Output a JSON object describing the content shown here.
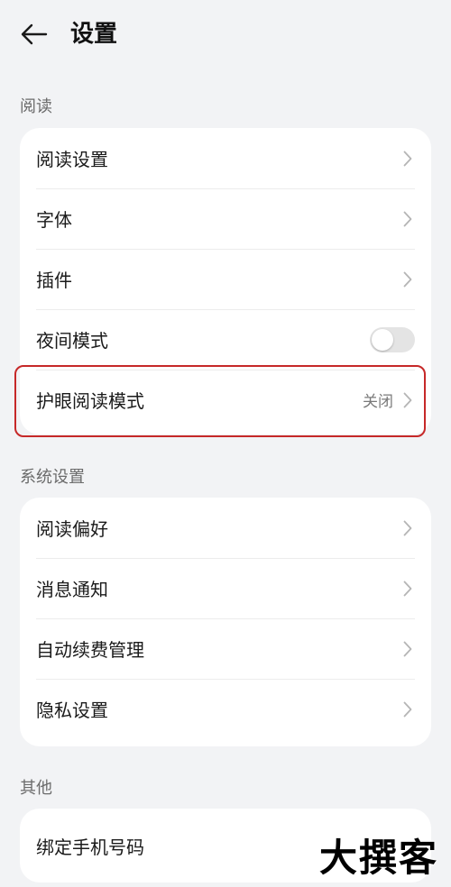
{
  "header": {
    "back_icon": "arrow-left-icon",
    "title": "设置"
  },
  "sections": {
    "reading": {
      "label": "阅读",
      "items": {
        "reading_settings": "阅读设置",
        "font": "字体",
        "plugins": "插件",
        "night_mode": "夜间模式",
        "eye_protection": "护眼阅读模式",
        "eye_protection_value": "关闭"
      }
    },
    "system": {
      "label": "系统设置",
      "items": {
        "reading_preference": "阅读偏好",
        "notifications": "消息通知",
        "auto_renewal": "自动续费管理",
        "privacy": "隐私设置"
      }
    },
    "other": {
      "label": "其他",
      "items": {
        "bind_phone": "绑定手机号码"
      }
    }
  },
  "toggles": {
    "night_mode_on": false
  },
  "colors": {
    "background": "#f2f3f5",
    "card": "#ffffff",
    "highlight": "#c62828",
    "toggle_off": "#e4e4e4"
  },
  "watermark": "大撰客"
}
